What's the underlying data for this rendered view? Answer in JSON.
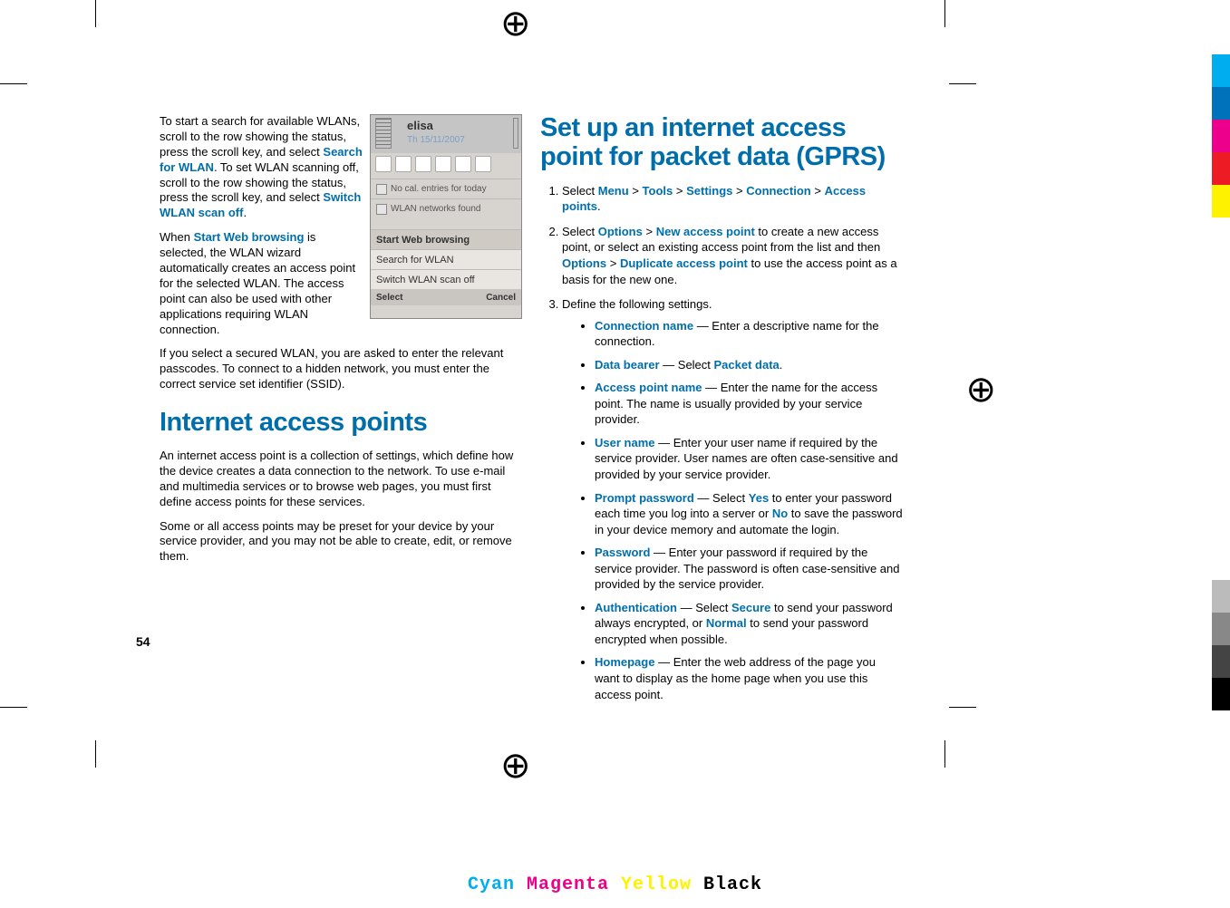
{
  "left": {
    "para1_pre": "To start a search for available WLANs, scroll to the row showing the status, press the scroll key, and select ",
    "search_for_wlan": "Search for WLAN",
    "para1_mid": ". To set WLAN scanning off, scroll to the row showing the status, press the scroll key, and select ",
    "switch_wlan_scan_off": "Switch WLAN scan off",
    "para1_end": ".",
    "para2_pre": "When ",
    "start_web_browsing": "Start Web browsing",
    "para2_post": " is selected, the WLAN wizard automatically creates an access point for the selected WLAN. The access point can also be used with other applications requiring WLAN connection.",
    "para3": "If you select a secured WLAN, you are asked to enter the relevant passcodes. To connect to a hidden network, you must enter the correct service set identifier (SSID).",
    "heading": "Internet access points",
    "para4": "An internet access point is a collection of settings, which define how the device creates a data connection to the network. To use e-mail and multimedia services or to browse web pages, you must first define access points for these services.",
    "para5": "Some or all access points may be preset for your device by your service provider, and you may not be able to create, edit, or remove them."
  },
  "phone": {
    "operator": "elisa",
    "date": "Th 15/11/2007",
    "line1": "No cal. entries for today",
    "line2": "WLAN networks found",
    "menu1": "Start Web browsing",
    "menu2": "Search for WLAN",
    "menu3": "Switch WLAN scan off",
    "sk_left": "Select",
    "sk_right": "Cancel"
  },
  "right": {
    "heading": "Set up an internet access point for packet data (GPRS)",
    "step1_pre": "Select ",
    "menu": "Menu",
    "gt": ">",
    "tools": "Tools",
    "settings": "Settings",
    "connection": "Connection",
    "access_points": "Access points",
    "step1_end": ".",
    "step2_pre": "Select ",
    "options": "Options",
    "new_access_point": "New access point",
    "step2_mid": " to create a new access point, or select an existing access point from the list and then ",
    "duplicate_access_point": "Duplicate access point",
    "step2_end": " to use the access point as a basis for the new one.",
    "step3": "Define the following settings.",
    "b1_label": "Connection name",
    "b1_text": " — Enter a descriptive name for the connection.",
    "b2_label": "Data bearer",
    "b2_pre": " — Select ",
    "b2_val": "Packet data",
    "b2_end": ".",
    "b3_label": "Access point name",
    "b3_text": " — Enter the name for the access point. The name is usually provided by your service provider.",
    "b4_label": "User name",
    "b4_text": " — Enter your user name if required by the service provider. User names are often case-sensitive and provided by your service provider.",
    "b5_label": "Prompt password",
    "b5_pre": " — Select ",
    "b5_yes": "Yes",
    "b5_mid": " to enter your password each time you log into a server or ",
    "b5_no": "No",
    "b5_end": " to save the password in your device memory and automate the login.",
    "b6_label": "Password",
    "b6_text": " — Enter your password if required by the service provider. The password is often case-sensitive and provided by the service provider.",
    "b7_label": "Authentication",
    "b7_pre": " — Select ",
    "b7_secure": "Secure",
    "b7_mid": " to send your password always encrypted, or ",
    "b7_normal": "Normal",
    "b7_end": " to send your password encrypted when possible.",
    "b8_label": "Homepage",
    "b8_text": " — Enter the web address of the page you want to display as the home page when you use this access point."
  },
  "page_number": "54",
  "cmyk": {
    "c": "Cyan",
    "m": "Magenta",
    "y": "Yellow",
    "k": "Black"
  }
}
